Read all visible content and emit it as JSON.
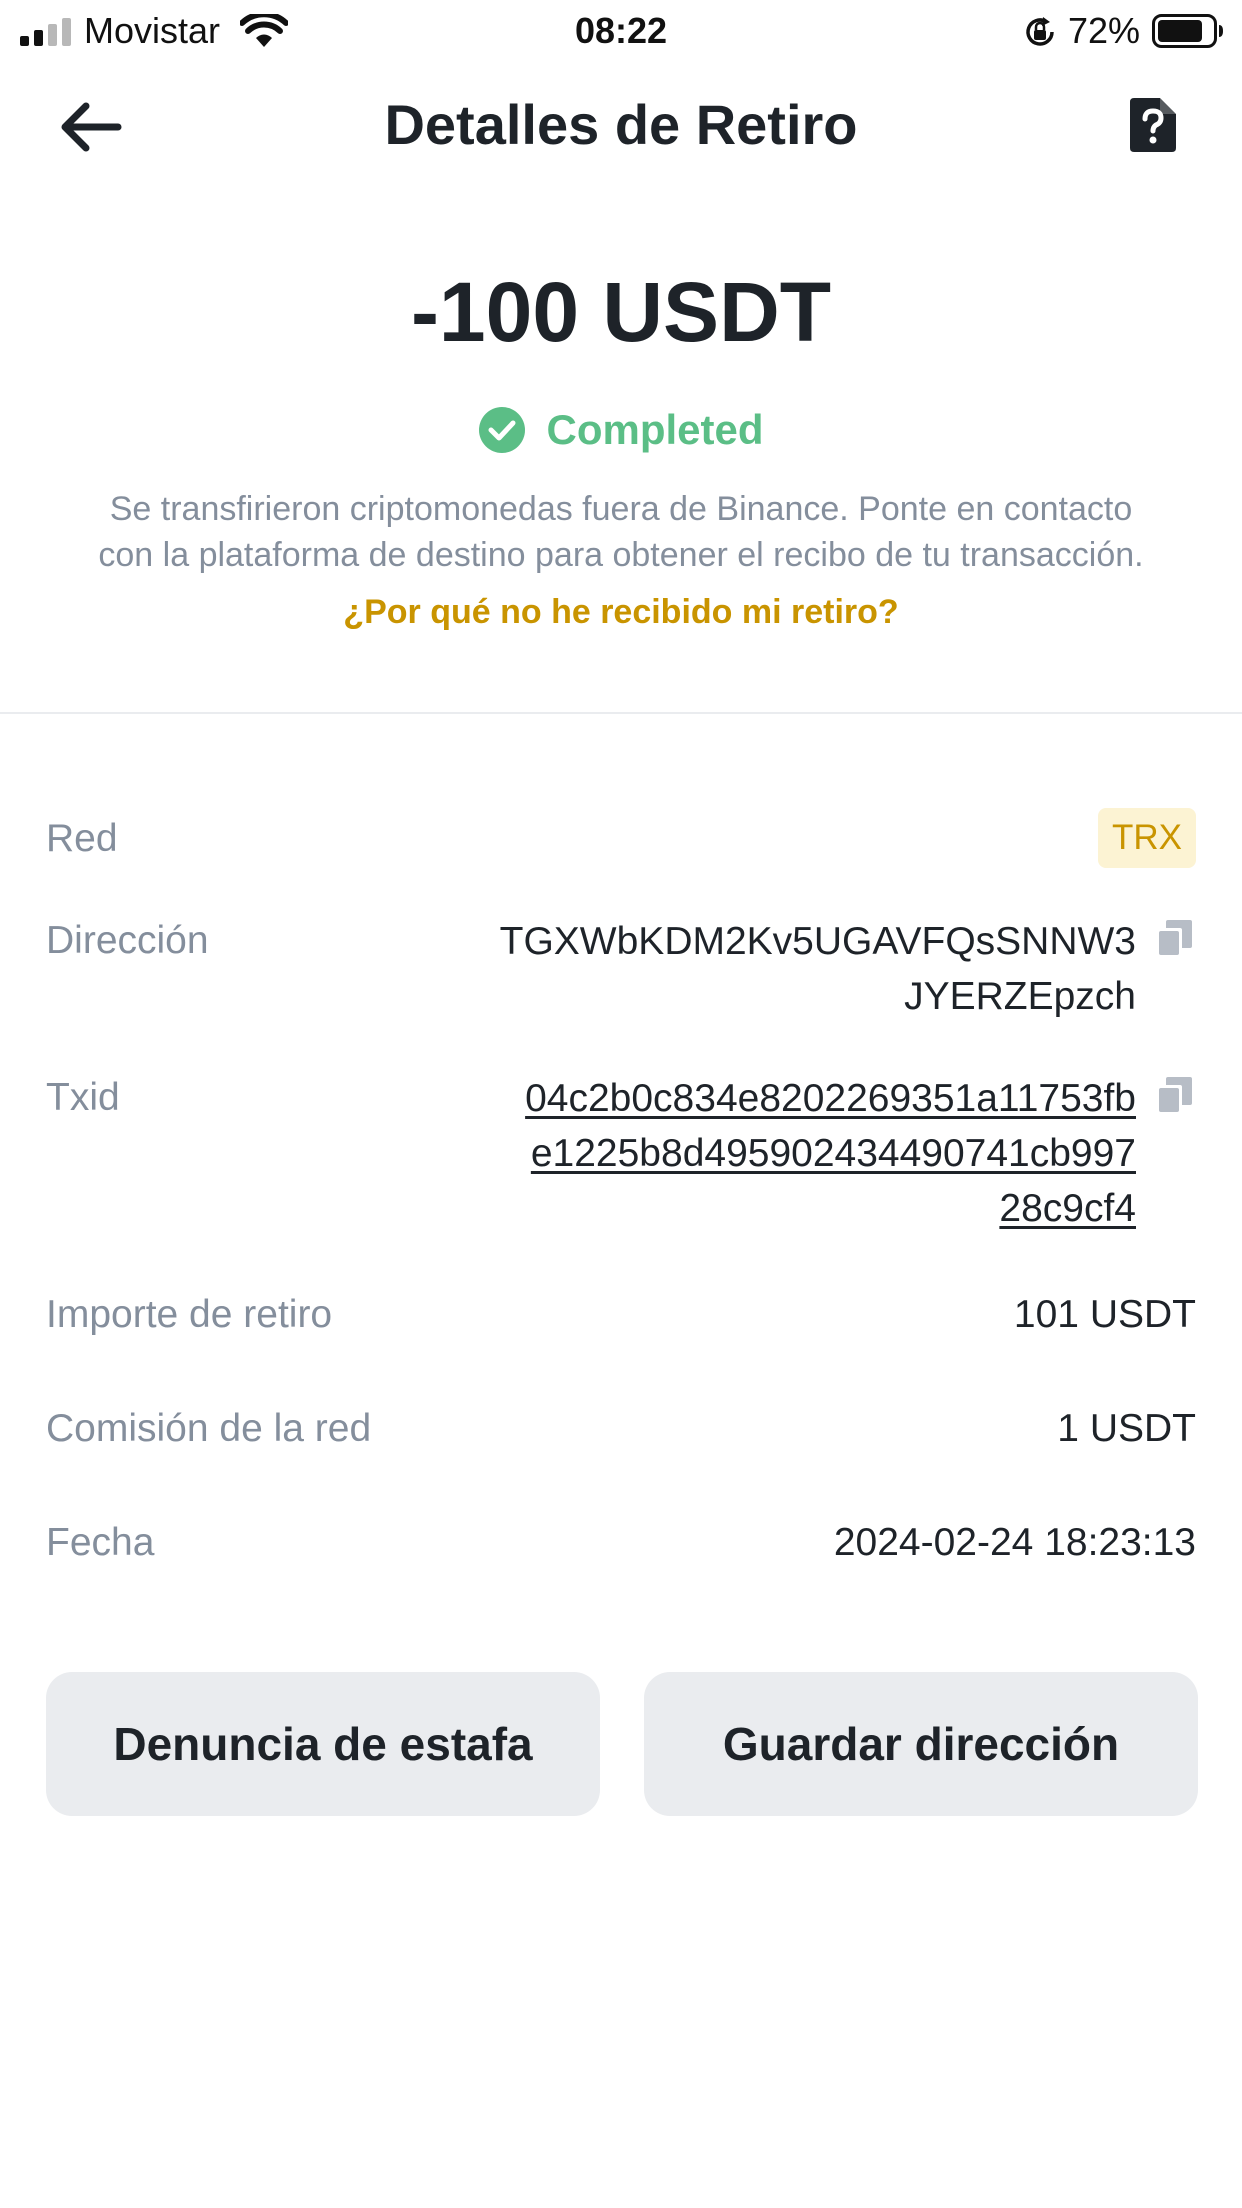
{
  "status_bar": {
    "carrier": "Movistar",
    "time": "08:22",
    "battery_percent": "72%",
    "battery_level": 0.72
  },
  "header": {
    "title": "Detalles de Retiro",
    "back_icon": "arrow-left-icon",
    "help_icon": "help-document-icon"
  },
  "summary": {
    "amount": "-100 USDT",
    "status": "Completed",
    "status_color": "#5bbe86",
    "info_line1": "Se transfirieron criptomonedas fuera de Binance. Ponte en contacto",
    "info_line2": "con la plataforma de destino para obtener el recibo de tu transacción.",
    "link_text": "¿Por qué no he recibido mi retiro?",
    "link_color": "#c99400"
  },
  "details": {
    "network": {
      "label": "Red",
      "value": "TRX"
    },
    "address": {
      "label": "Dirección",
      "line1": "TGXWbKDM2Kv5UGAVFQsSNNW3",
      "line2": "JYERZEpzch"
    },
    "txid": {
      "label": "Txid",
      "line1": "04c2b0c834e8202269351a11753fb",
      "line2": "e1225b8d495902434490741cb997",
      "line3": "28c9cf4"
    },
    "amount": {
      "label": "Importe de retiro",
      "value": "101 USDT"
    },
    "fee": {
      "label": "Comisión de la red",
      "value": "1 USDT"
    },
    "date": {
      "label": "Fecha",
      "value": "2024-02-24 18:23:13"
    }
  },
  "actions": {
    "report_scam": "Denuncia de estafa",
    "save_address": "Guardar dirección"
  }
}
